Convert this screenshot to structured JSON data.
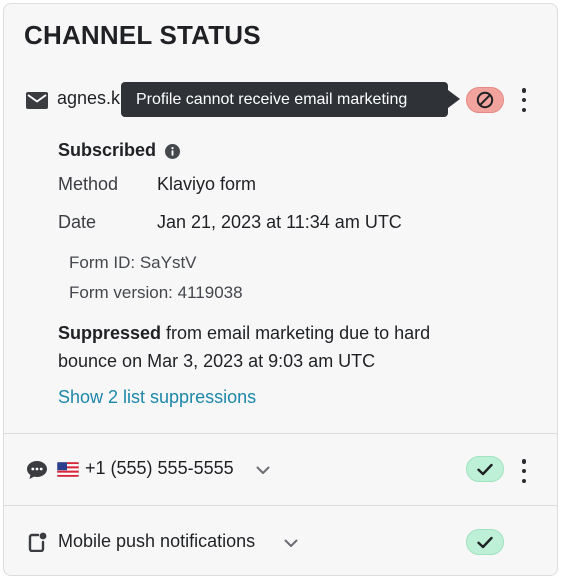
{
  "card": {
    "title": "CHANNEL STATUS"
  },
  "email": {
    "address_visible": "agnes.k",
    "tooltip": "Profile cannot receive email marketing",
    "status_icon": "blocked-icon",
    "status_color": "#f3a39e",
    "subscribed_label": "Subscribed",
    "method_label": "Method",
    "method_value": "Klaviyo form",
    "date_label": "Date",
    "date_value": "Jan 21, 2023 at 11:34 am UTC",
    "form_id_line": "Form ID: SaYstV",
    "form_version_line": "Form version: 4119038",
    "suppressed_bold": "Suppressed",
    "suppressed_rest": " from email marketing due to hard bounce on Mar 3, 2023 at 9:03 am UTC",
    "show_suppressions_link": "Show 2 list suppressions"
  },
  "sms": {
    "phone": "+1 (555) 555-5555",
    "status_icon": "checkmark-icon",
    "status_color": "#bdf0d6"
  },
  "push": {
    "label": "Mobile push notifications",
    "status_icon": "checkmark-icon",
    "status_color": "#bdf0d6"
  },
  "colors": {
    "link": "#1d87a8",
    "tooltip_bg": "#2f3338",
    "card_bg": "#f7f7f8"
  }
}
